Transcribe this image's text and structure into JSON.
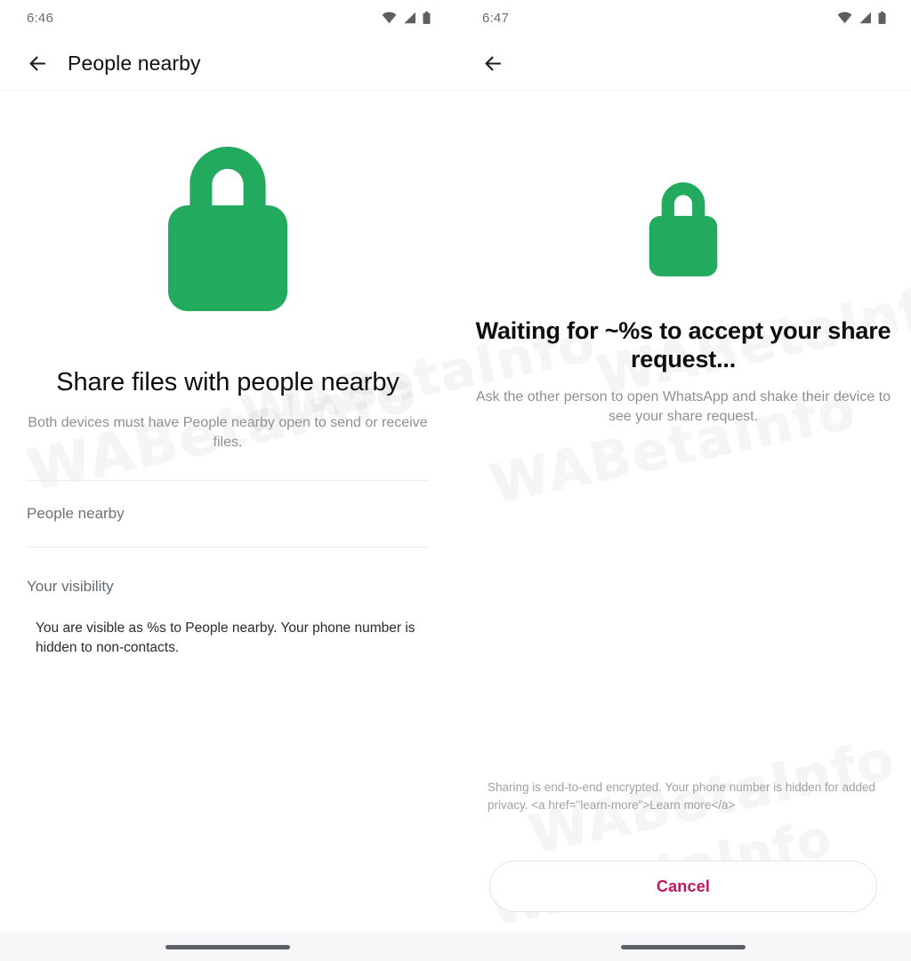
{
  "brand": {
    "lock_color": "#22AA5F",
    "cancel_color": "#C2185B",
    "watermark_text": "WABetaInfo"
  },
  "screens": [
    {
      "id": "people-nearby",
      "status_bar": {
        "time": "6:46",
        "icons": [
          "wifi-icon",
          "cellular-signal-icon",
          "battery-icon"
        ]
      },
      "app_bar": {
        "back_icon": "back-arrow-icon",
        "title": "People nearby"
      },
      "hero": {
        "icon": "lock-icon"
      },
      "headline": "Share files with people nearby",
      "subtext": "Both devices must have People nearby open to send or receive files.",
      "list_row": {
        "label": "People nearby"
      },
      "section_header": {
        "label": "Your visibility"
      },
      "body": "You are visible as %s to People nearby. Your phone number is hidden to non-contacts.",
      "nav": {
        "pill": "home-gesture-pill"
      }
    },
    {
      "id": "waiting-for-accept",
      "status_bar": {
        "time": "6:47",
        "icons": [
          "wifi-icon",
          "cellular-signal-icon",
          "battery-icon"
        ]
      },
      "app_bar": {
        "back_icon": "back-arrow-icon",
        "title": ""
      },
      "hero": {
        "icon": "lock-icon"
      },
      "headline": "Waiting for ~%s to accept your share request...",
      "subtext": "Ask the other person to open WhatsApp and shake their device to see your share request.",
      "footer_note": "Sharing is end-to-end encrypted. Your phone number is hidden for added privacy. <a href=\"learn-more\">Learn more</a>",
      "cancel_button": {
        "label": "Cancel"
      },
      "nav": {
        "pill": "home-gesture-pill"
      }
    }
  ]
}
